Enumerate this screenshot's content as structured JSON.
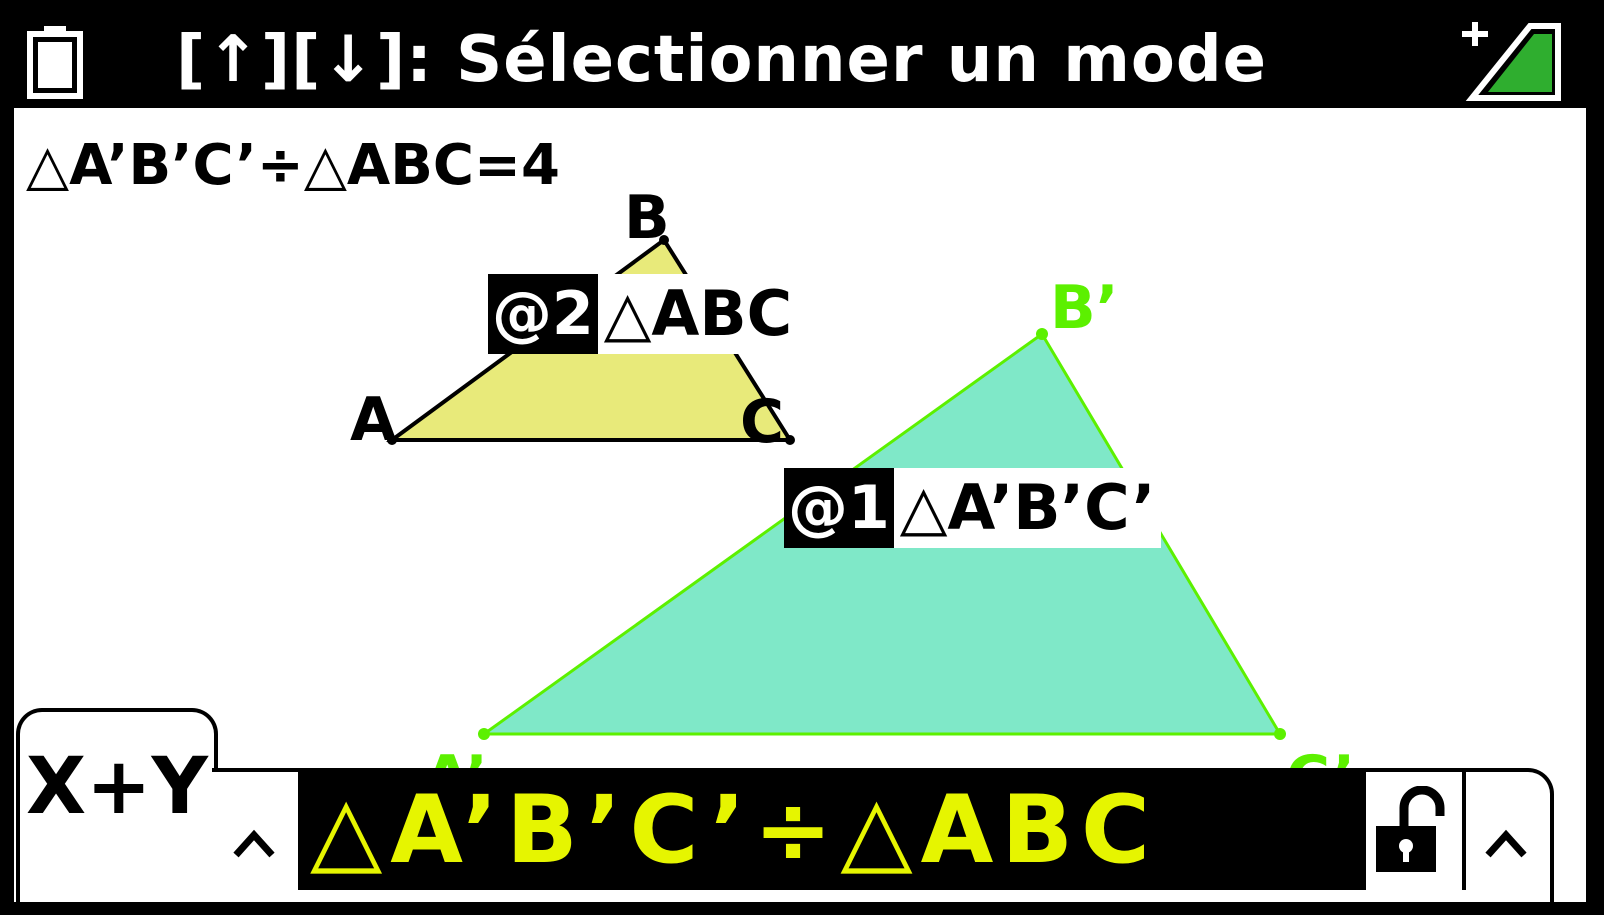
{
  "status_bar": {
    "title": "[↑][↓]: Sélectionner un mode",
    "battery_icon": "battery-icon",
    "signal_icon": "signal-icon"
  },
  "result": {
    "text": "△A’B’C’÷△ABC=4"
  },
  "geometry": {
    "triangle_small": {
      "vertex_a": "A",
      "vertex_b": "B",
      "vertex_c": "C",
      "tag_number": "@2",
      "tag_name": "△ABC",
      "fill_color": "#e8ea7a",
      "stroke_color": "#000000"
    },
    "triangle_large": {
      "vertex_a": "A’",
      "vertex_b": "B’",
      "vertex_c": "C’",
      "tag_number": "@1",
      "tag_name": "△A’B’C’",
      "fill_color": "#7fe8c8",
      "stroke_color": "#5cf000"
    }
  },
  "bottom": {
    "tab_label": "X+Y",
    "expression": "△A’B’C’÷△ABC",
    "expression_color": "#e6f500",
    "caret_icon": "caret-up-icon",
    "lock_icon": "unlock-icon"
  }
}
